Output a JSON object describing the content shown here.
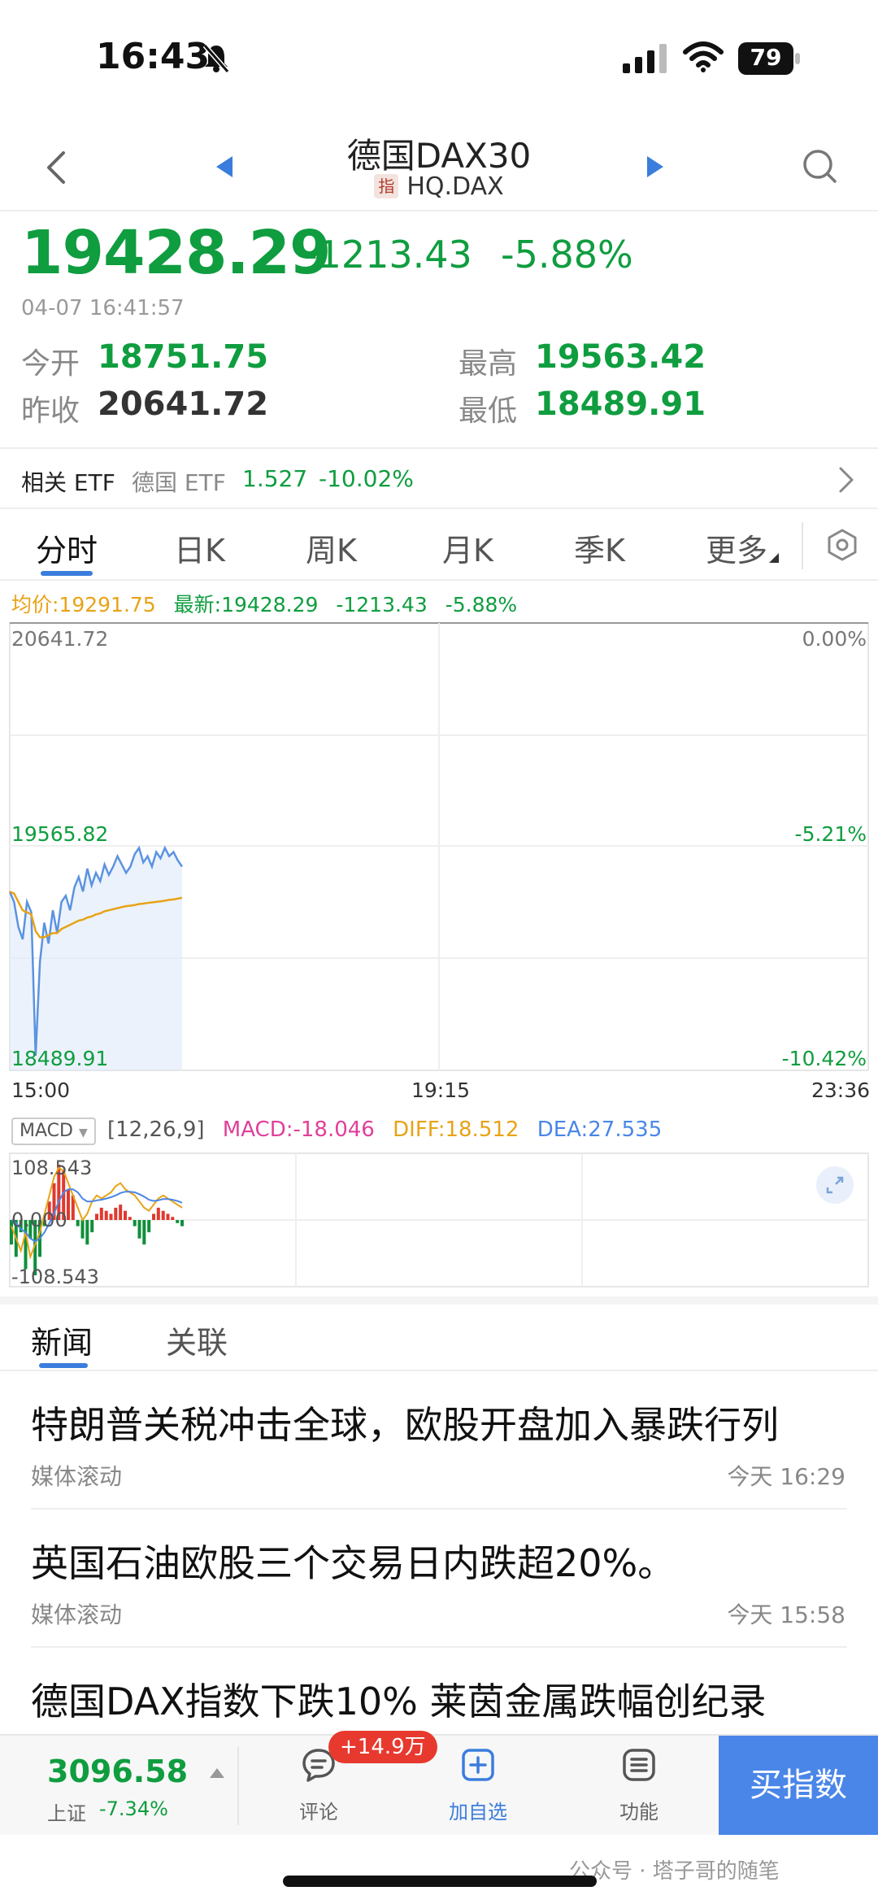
{
  "status": {
    "time": "16:43",
    "battery": "79"
  },
  "nav": {
    "title": "德国DAX30",
    "badge": "指",
    "code": "HQ.DAX"
  },
  "quote": {
    "price": "19428.29",
    "change": "-1213.43",
    "change_pct": "-5.88%",
    "datetime": "04-07 16:41:57",
    "open_label": "今开",
    "open": "18751.75",
    "high_label": "最高",
    "high": "19563.42",
    "prev_close_label": "昨收",
    "prev_close": "20641.72",
    "low_label": "最低",
    "low": "18489.91"
  },
  "etf": {
    "label": "相关 ETF",
    "name": "德国 ETF",
    "price": "1.527",
    "pct": "-10.02%"
  },
  "tabs": [
    {
      "label": "分时"
    },
    {
      "label": "日K"
    },
    {
      "label": "周K"
    },
    {
      "label": "月K"
    },
    {
      "label": "季K"
    },
    {
      "label": "更多"
    }
  ],
  "chart_header": {
    "avg": "均价:19291.75",
    "latest": "最新:19428.29",
    "change": "-1213.43",
    "pct": "-5.88%"
  },
  "chart_data": {
    "type": "line",
    "title": "",
    "x_ticks": [
      "15:00",
      "19:15",
      "23:36"
    ],
    "y_left_ticks": [
      "20641.72",
      "19565.82",
      "18489.91"
    ],
    "y_right_ticks": [
      "0.00%",
      "-5.21%",
      "-10.42%"
    ],
    "ylim": [
      18489.91,
      20641.72
    ],
    "series": [
      {
        "values": [
          19350,
          19300,
          19180,
          19120,
          19300,
          19250,
          18560,
          19010,
          19200,
          19100,
          19260,
          19150,
          19300,
          19330,
          19260,
          19370,
          19420,
          19350,
          19460,
          19380,
          19440,
          19400,
          19480,
          19430,
          19470,
          19520,
          19480,
          19440,
          19470,
          19530,
          19560,
          19490,
          19520,
          19470,
          19540,
          19510,
          19560,
          19520,
          19540,
          19500,
          19470
        ]
      },
      {
        "values": [
          19350,
          19340,
          19300,
          19260,
          19250,
          19240,
          19160,
          19130,
          19130,
          19140,
          19150,
          19150,
          19170,
          19180,
          19190,
          19200,
          19210,
          19215,
          19225,
          19230,
          19240,
          19245,
          19255,
          19260,
          19265,
          19270,
          19275,
          19280,
          19282,
          19285,
          19290,
          19292,
          19295,
          19298,
          19300,
          19303,
          19306,
          19310,
          19312,
          19316,
          19320
        ]
      }
    ]
  },
  "macd": {
    "select_label": "MACD",
    "params": "[12,26,9]",
    "macd": "MACD:-18.046",
    "diff": "DIFF:18.512",
    "dea": "DEA:27.535",
    "y_top": "108.543",
    "y_mid": "0.000",
    "y_bottom": "-108.543",
    "ylim": [
      -108.543,
      108.543
    ],
    "bars": [
      -40,
      -60,
      -20,
      -80,
      -30,
      -90,
      -60,
      -10,
      30,
      60,
      90,
      80,
      50,
      40,
      -10,
      -30,
      -40,
      -20,
      10,
      20,
      15,
      10,
      20,
      25,
      15,
      5,
      -10,
      -30,
      -40,
      -20,
      10,
      20,
      15,
      10,
      5,
      -5,
      -10
    ],
    "diff_values": [
      -10,
      -30,
      -50,
      -20,
      -60,
      -40,
      -20,
      10,
      40,
      70,
      85,
      80,
      60,
      40,
      20,
      0,
      10,
      30,
      40,
      35,
      40,
      45,
      55,
      60,
      50,
      45,
      40,
      30,
      20,
      15,
      25,
      35,
      40,
      35,
      30,
      25,
      20
    ],
    "dea_values": [
      0,
      -5,
      -15,
      -20,
      -30,
      -35,
      -30,
      -20,
      -5,
      10,
      30,
      45,
      50,
      50,
      45,
      35,
      30,
      30,
      32,
      33,
      35,
      37,
      40,
      44,
      46,
      46,
      45,
      42,
      38,
      33,
      31,
      32,
      34,
      34,
      33,
      31,
      28
    ]
  },
  "news_tabs": [
    {
      "label": "新闻"
    },
    {
      "label": "关联"
    }
  ],
  "news": [
    {
      "title": "特朗普关税冲击全球，欧股开盘加入暴跌行列",
      "source": "媒体滚动",
      "time": "今天 16:29"
    },
    {
      "title": "英国石油欧股三个交易日内跌超20%。",
      "source": "媒体滚动",
      "time": "今天 15:58"
    },
    {
      "title": "德国DAX指数下跌10% 莱茵金属跌幅创纪录",
      "source": "",
      "time": ""
    }
  ],
  "bottom": {
    "index_price": "3096.58",
    "index_name": "上证",
    "index_pct": "-7.34%",
    "comment_badge": "+14.9万",
    "comment_label": "评论",
    "add_label": "加自选",
    "func_label": "功能",
    "buy_label": "买指数"
  },
  "watermark": "公众号 · 塔子哥的随笔",
  "colors": {
    "down": "#0f9d3f",
    "accent": "#3b7ddd",
    "avg": "#e8a317",
    "macd": "#e0409a",
    "dea": "#4a86e8",
    "buy": "#4a86e8"
  }
}
